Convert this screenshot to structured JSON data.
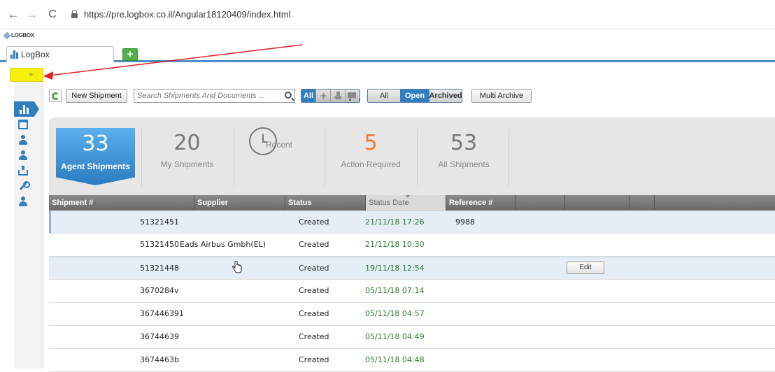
{
  "browser": {
    "back_icon": "←",
    "forward_icon": "→",
    "reload_icon": "C",
    "url": "https://pre.logbox.co.il/Angular18120409/index.html"
  },
  "app": {
    "logo_text": "LOGBOX",
    "tab_label": "LogBox",
    "add_tab_label": "+",
    "expand_label": "»"
  },
  "toolbar": {
    "new_shipment": "New Shipment",
    "search_placeholder": "Search Shipments And Documents ...",
    "mode_all": "All",
    "filter_all": "All",
    "filter_open": "Open",
    "filter_archived": "Archived",
    "multi_archive": "Multi Archive"
  },
  "stats": [
    {
      "count": "33",
      "label": "Agent Shipments"
    },
    {
      "count": "20",
      "label": "My Shipments"
    },
    {
      "count": "",
      "label": "Recent"
    },
    {
      "count": "5",
      "label": "Action Required"
    },
    {
      "count": "53",
      "label": "All Shipments"
    }
  ],
  "colors": {
    "accent": "#2f7fc1",
    "action_required": "#f07a2a",
    "date_green": "#2a7b2a",
    "annotation_highlight": "#f8f00c",
    "annotation_arrow": "#e02020"
  },
  "grid": {
    "columns": [
      "Shipment #",
      "Supplier",
      "Status",
      "Status Date",
      "Reference #"
    ],
    "rows": [
      {
        "shipment": "51321451",
        "supplier": "",
        "status": "Created",
        "date": "21/11/18 17:26",
        "reference": "9988"
      },
      {
        "shipment": "51321450",
        "supplier": "Eads Airbus Gmbh(EL)",
        "status": "Created",
        "date": "21/11/18 10:30",
        "reference": ""
      },
      {
        "shipment": "51321448",
        "supplier": "",
        "status": "Created",
        "date": "19/11/18 12:54",
        "reference": ""
      },
      {
        "shipment": "3670284v",
        "supplier": "",
        "status": "Created",
        "date": "05/11/18 07:14",
        "reference": ""
      },
      {
        "shipment": "367446391",
        "supplier": "",
        "status": "Created",
        "date": "05/11/18 04:57",
        "reference": ""
      },
      {
        "shipment": "36744639",
        "supplier": "",
        "status": "Created",
        "date": "05/11/18 04:49",
        "reference": ""
      },
      {
        "shipment": "3674463b",
        "supplier": "",
        "status": "Created",
        "date": "05/11/18 04:48",
        "reference": ""
      }
    ],
    "edit_label": "Edit"
  }
}
